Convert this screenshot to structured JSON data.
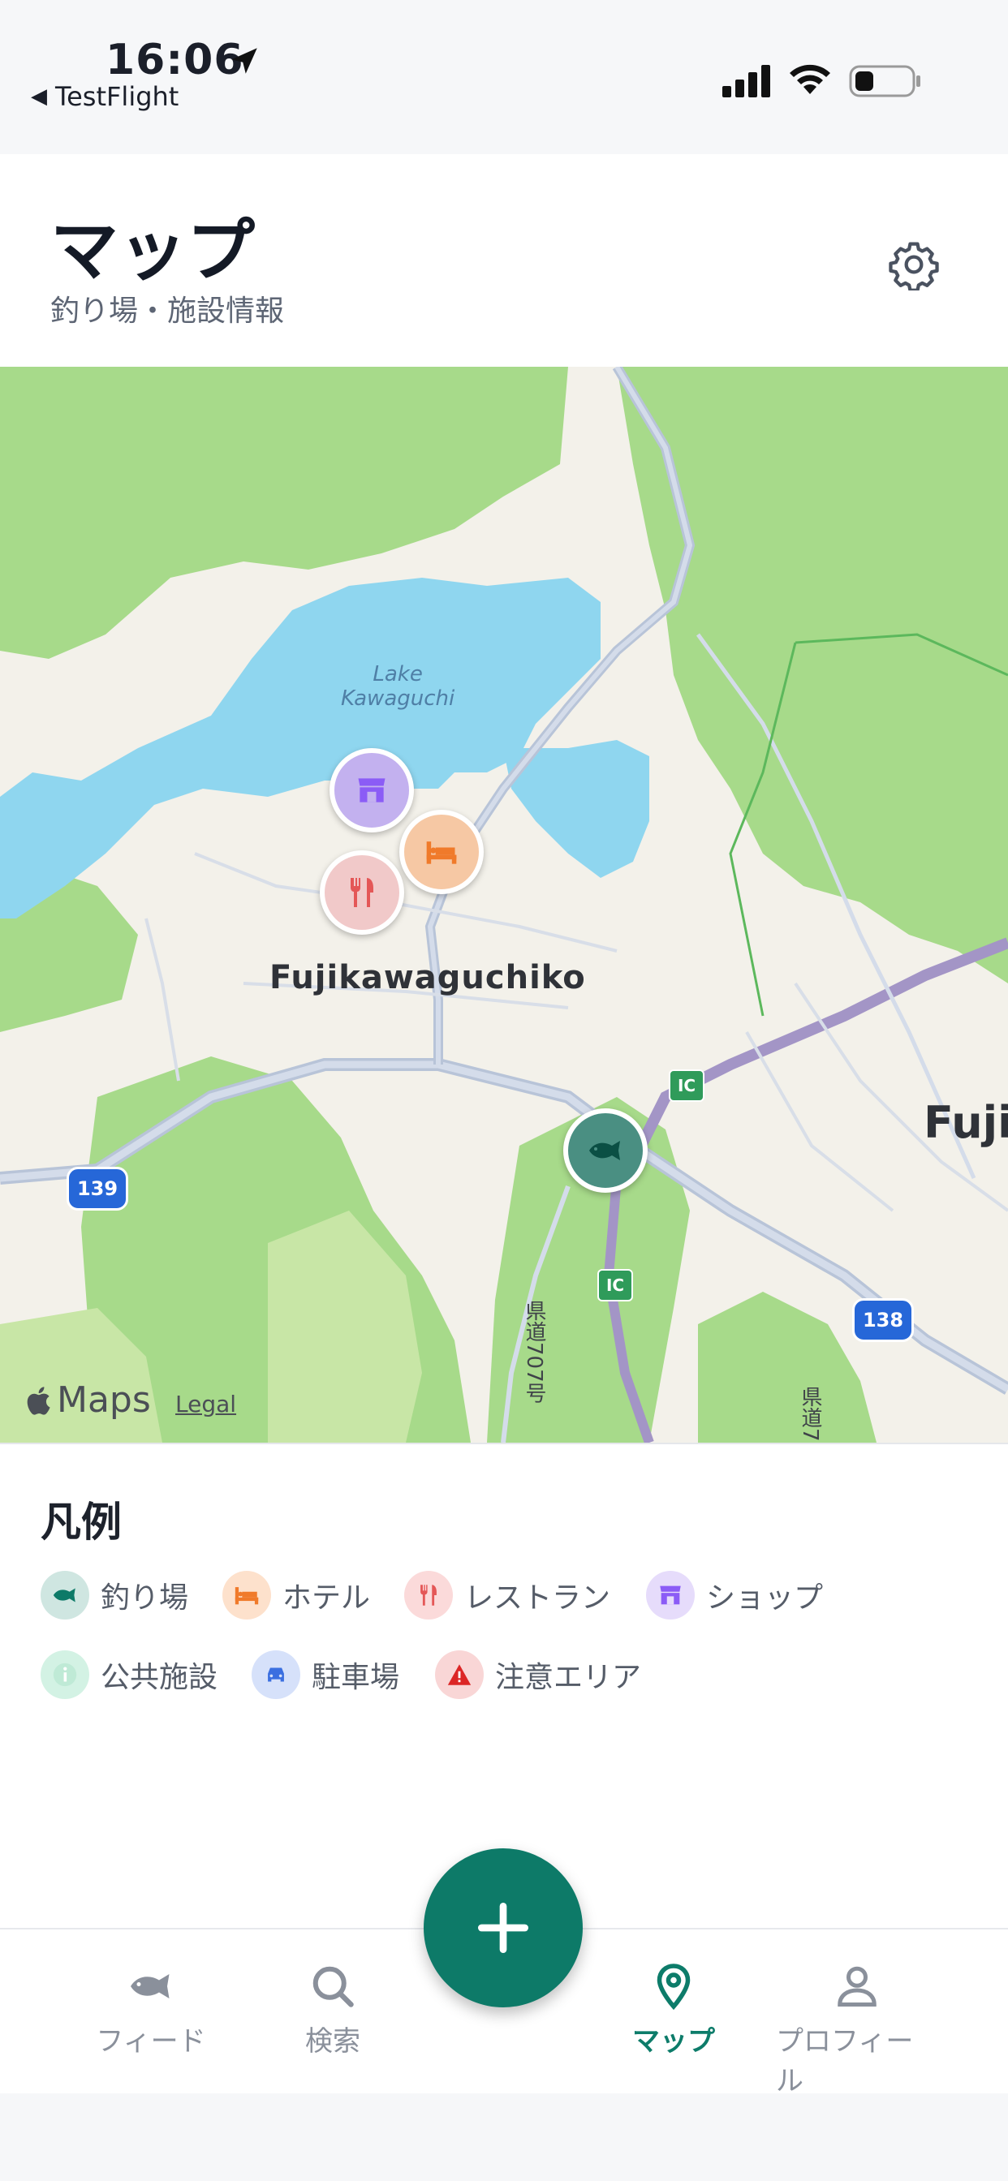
{
  "status_bar": {
    "time": "16:06",
    "back_app": "TestFlight"
  },
  "header": {
    "title": "マップ",
    "subtitle": "釣り場・施設情報"
  },
  "map": {
    "lake_label_line1": "Lake",
    "lake_label_line2": "Kawaguchi",
    "town_label": "Fujikawaguchiko",
    "city_label": "Fujiy",
    "route_139": "139",
    "route_138": "138",
    "ic_badge": "IC",
    "pref_road_1": "県道707号",
    "pref_road_2": "県道7",
    "maps_logo": "Maps",
    "legal": "Legal",
    "pins": [
      "shop",
      "hotel",
      "restaurant",
      "fishing-spot"
    ]
  },
  "legend": {
    "title": "凡例",
    "items": [
      {
        "label": "釣り場",
        "icon": "fish-icon",
        "color": "#0d7a68",
        "bg": "#cfe6e1"
      },
      {
        "label": "ホテル",
        "icon": "bed-icon",
        "color": "#f07a2a",
        "bg": "#fde1cc"
      },
      {
        "label": "レストラン",
        "icon": "utensils-icon",
        "color": "#e45757",
        "bg": "#fbdada"
      },
      {
        "label": "ショップ",
        "icon": "store-icon",
        "color": "#8b5cf6",
        "bg": "#e6dcfb"
      },
      {
        "label": "公共施設",
        "icon": "info-icon",
        "color": "#34c28a",
        "bg": "#d3f2e4"
      },
      {
        "label": "駐車場",
        "icon": "car-icon",
        "color": "#3b6fe0",
        "bg": "#d6e1fa"
      },
      {
        "label": "注意エリア",
        "icon": "warning-icon",
        "color": "#dc2626",
        "bg": "#f9d6d6"
      }
    ]
  },
  "tabbar": {
    "tabs": [
      {
        "label": "フィード",
        "icon": "fish-icon"
      },
      {
        "label": "検索",
        "icon": "search-icon"
      },
      {
        "label": "マップ",
        "icon": "map-pin-icon",
        "active": true
      },
      {
        "label": "プロフィール",
        "icon": "user-icon"
      }
    ],
    "fab_icon": "plus-icon"
  },
  "colors": {
    "accent": "#0d7a68",
    "water": "#8fd6ef",
    "forest": "#a9dc8c"
  }
}
